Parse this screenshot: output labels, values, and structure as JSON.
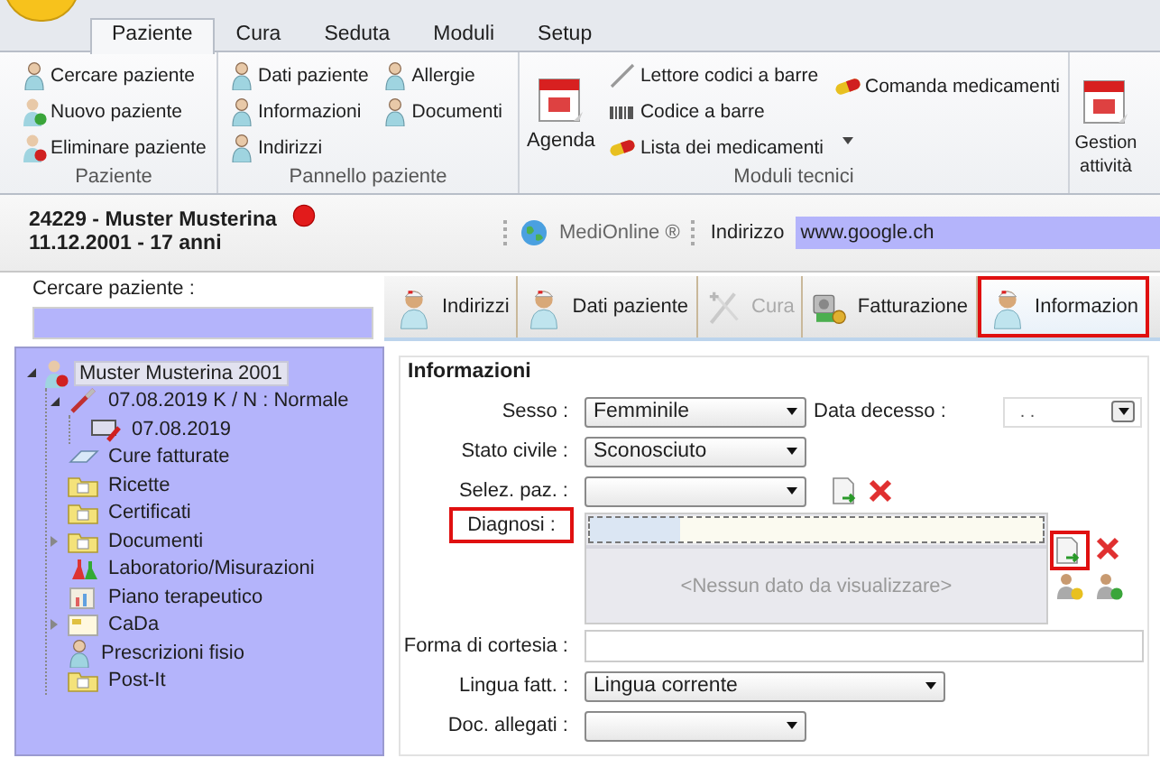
{
  "ribbon": {
    "tabs": [
      {
        "label": "Paziente",
        "selected": true
      },
      {
        "label": "Cura",
        "selected": false
      },
      {
        "label": "Seduta",
        "selected": false
      },
      {
        "label": "Moduli",
        "selected": false
      },
      {
        "label": "Setup",
        "selected": false
      }
    ],
    "groups": [
      {
        "title": "Paziente",
        "kind": "list",
        "items": [
          "Cercare paziente",
          "Nuovo paziente",
          "Eliminare paziente"
        ]
      },
      {
        "title": "Pannello paziente",
        "kind": "grid",
        "items": [
          "Dati paziente",
          "Allergie",
          "Informazioni",
          "Documenti",
          "Indirizzi"
        ]
      },
      {
        "title": "Moduli tecnici",
        "kind": "tech",
        "large_button": "Agenda",
        "items": [
          "Lettore codici a barre",
          "Codice a barre",
          "Lista dei medicamenti"
        ],
        "side_items": [
          "Comanda medicamenti"
        ]
      },
      {
        "kind": "large",
        "large_button": "Gestion attività"
      }
    ]
  },
  "patient": {
    "name": "24229 - Muster Musterina",
    "birth": "11.12.2001 - 17 anni",
    "service": "MediOnline ®",
    "address_label": "Indirizzo",
    "address_value": "www.google.ch"
  },
  "search": {
    "label": "Cercare paziente :"
  },
  "tree": [
    {
      "label": "Muster Musterina 2001",
      "selected": true,
      "expanded": true,
      "children": [
        {
          "label": "07.08.2019 K / N : Normale",
          "selected": false,
          "expanded": true,
          "children": [
            {
              "label": "07.08.2019",
              "selected": false
            }
          ]
        },
        {
          "label": "Cure fatturate",
          "selected": false
        },
        {
          "label": "Ricette",
          "selected": false
        },
        {
          "label": "Certificati",
          "selected": false
        },
        {
          "label": "Documenti",
          "selected": false,
          "expanded": false
        },
        {
          "label": "Laboratorio/Misurazioni",
          "selected": false
        },
        {
          "label": "Piano terapeutico",
          "selected": false
        },
        {
          "label": "CaDa",
          "selected": false,
          "expanded": false
        },
        {
          "label": "Prescrizioni fisio",
          "selected": false
        },
        {
          "label": "Post-It",
          "selected": false
        }
      ]
    }
  ],
  "record_tabs": [
    {
      "label": "Indirizzi",
      "selected": false,
      "disabled": false,
      "highlighted": false
    },
    {
      "label": "Dati paziente",
      "selected": false,
      "disabled": false,
      "highlighted": false
    },
    {
      "label": "Cura",
      "selected": false,
      "disabled": true,
      "highlighted": false
    },
    {
      "label": "Fatturazione",
      "selected": false,
      "disabled": false,
      "highlighted": false
    },
    {
      "label": "Informazion",
      "selected": true,
      "disabled": false,
      "highlighted": true
    }
  ],
  "form": {
    "title": "Informazioni",
    "rows": [
      {
        "label": "Sesso :",
        "kind": "select_date",
        "value": "Femminile",
        "second_label": "Data decesso :",
        "second_value": ". ."
      },
      {
        "label": "Stato civile :",
        "kind": "select",
        "value": "Sconosciuto"
      },
      {
        "label": "Selez. paz. :",
        "kind": "select_actions"
      },
      {
        "label": "Diagnosi :",
        "kind": "grid",
        "label_highlighted": true,
        "add_highlighted": true,
        "empty_text": "<Nessun dato da visualizzare>"
      },
      {
        "label": "Forma di cortesia :",
        "kind": "text"
      },
      {
        "label": "Lingua fatt. :",
        "kind": "wide_select",
        "value": "Lingua corrente"
      },
      {
        "label": "Doc. allegati :",
        "kind": "select"
      }
    ]
  }
}
